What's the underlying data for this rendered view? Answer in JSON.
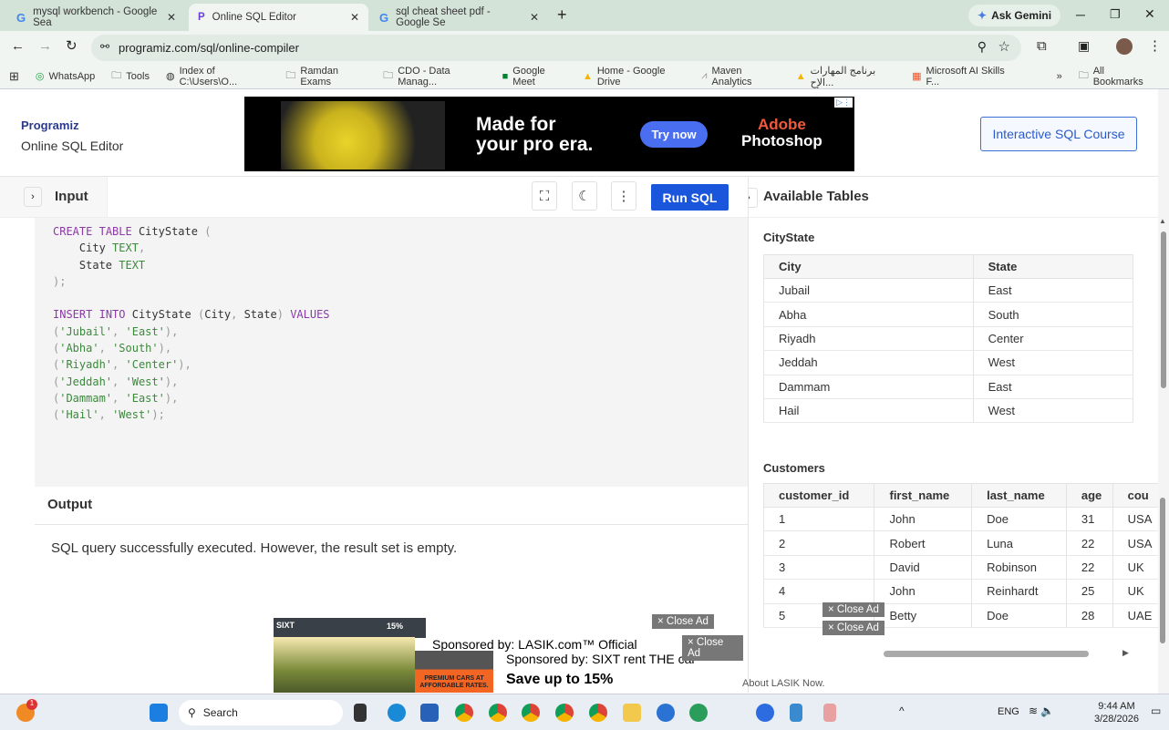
{
  "browser": {
    "tabs": [
      {
        "label": "mysql workbench - Google Sea",
        "active": false
      },
      {
        "label": "Online SQL Editor",
        "active": true
      },
      {
        "label": "sql cheat sheet pdf - Google Se",
        "active": false
      }
    ],
    "ask_gemini": "Ask Gemini",
    "url": "programiz.com/sql/online-compiler",
    "bookmarks": [
      "WhatsApp",
      "Tools",
      "Index of C:\\Users\\O...",
      "Ramdan Exams",
      "CDO - Data Manag...",
      "Google Meet",
      "Home - Google Drive",
      "Maven Analytics",
      "برنامج المهارات الإح...",
      "Microsoft AI Skills F..."
    ],
    "all_bookmarks": "All Bookmarks"
  },
  "header": {
    "logo": "Programiz",
    "subtitle": "Online SQL Editor",
    "course_button": "Interactive SQL Course",
    "ad": {
      "headline1": "Made for",
      "headline2": "your pro era.",
      "cta": "Try now",
      "brand1": "Adobe",
      "brand2": "Photoshop"
    }
  },
  "toolbar": {
    "input_label": "Input",
    "run_label": "Run SQL"
  },
  "editor": {
    "lines": [
      "CREATE TABLE CityState (",
      "    City TEXT,",
      "    State TEXT",
      ");",
      "",
      "INSERT INTO CityState (City, State) VALUES",
      "('Jubail', 'East'),",
      "('Abha', 'South'),",
      "('Riyadh', 'Center'),",
      "('Jeddah', 'West'),",
      "('Dammam', 'East'),",
      "('Hail', 'West');"
    ]
  },
  "output": {
    "title": "Output",
    "message": "SQL query successfully executed. However, the result set is empty."
  },
  "available_tables": {
    "title": "Available Tables",
    "tables": [
      {
        "name": "CityState",
        "columns": [
          "City",
          "State"
        ],
        "rows": [
          [
            "Jubail",
            "East"
          ],
          [
            "Abha",
            "South"
          ],
          [
            "Riyadh",
            "Center"
          ],
          [
            "Jeddah",
            "West"
          ],
          [
            "Dammam",
            "East"
          ],
          [
            "Hail",
            "West"
          ]
        ]
      },
      {
        "name": "Customers",
        "columns": [
          "customer_id",
          "first_name",
          "last_name",
          "age",
          "cou"
        ],
        "rows": [
          [
            "1",
            "John",
            "Doe",
            "31",
            "USA"
          ],
          [
            "2",
            "Robert",
            "Luna",
            "22",
            "USA"
          ],
          [
            "3",
            "David",
            "Robinson",
            "22",
            "UK"
          ],
          [
            "4",
            "John",
            "Reinhardt",
            "25",
            "UK"
          ],
          [
            "5",
            "Betty",
            "Doe",
            "28",
            "UAE"
          ]
        ]
      }
    ]
  },
  "ads": {
    "close_label": "× Close Ad",
    "lasik": "Sponsored by: LASIK.com™ Official",
    "sixt": "Sponsored by: SIXT rent THE car",
    "sixt_offer": "Save up to 15%",
    "lasik_tail": "About LASIK Now.",
    "sixt_banner": "PREMIUM CARS AT AFFORDABLE RATES.",
    "sixt_logo": "SIXT",
    "badge": "15%"
  },
  "taskbar": {
    "search": "Search",
    "lang": "ENG",
    "time": "9:44 AM",
    "date": "3/28/2026",
    "notif_count": "1"
  }
}
